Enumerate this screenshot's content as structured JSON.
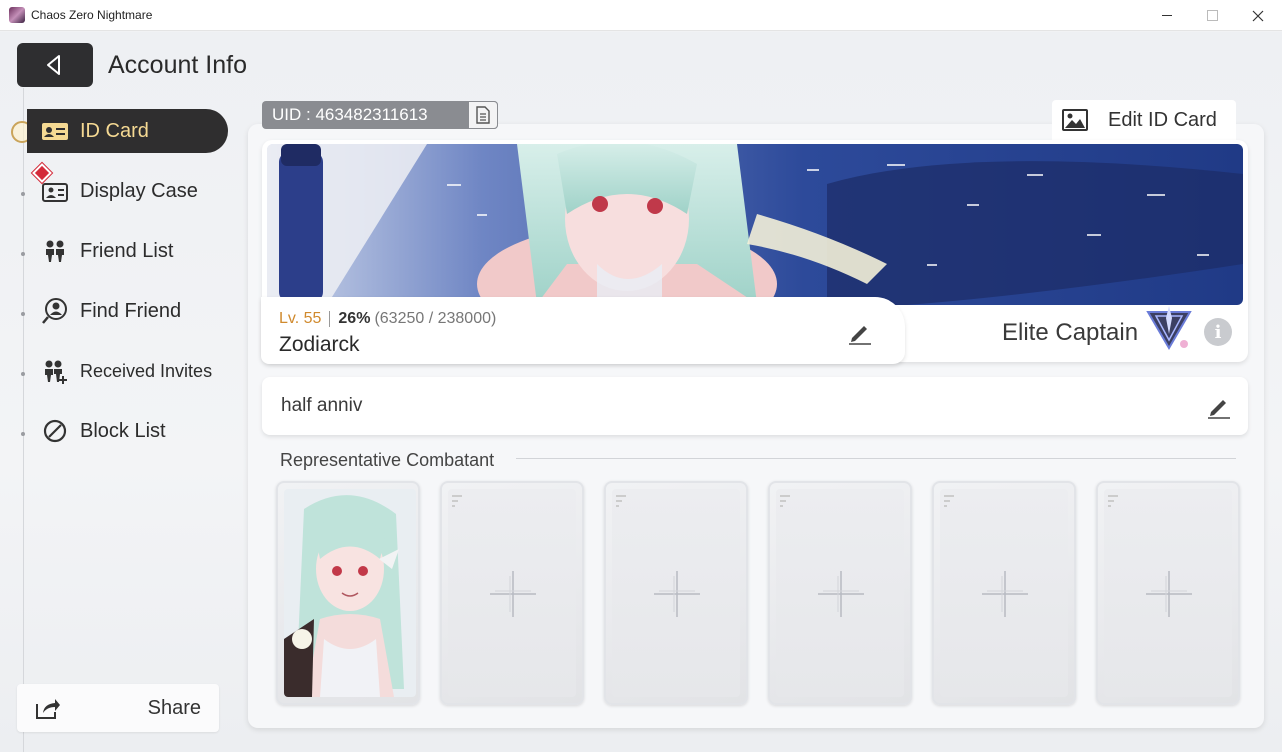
{
  "window": {
    "title": "Chaos Zero Nightmare"
  },
  "header": {
    "page_title": "Account Info"
  },
  "sidebar": {
    "items": [
      {
        "label": "ID Card",
        "icon": "id-card-icon",
        "active": true
      },
      {
        "label": "Display Case",
        "icon": "display-case-icon",
        "active": false,
        "badge": "new"
      },
      {
        "label": "Friend List",
        "icon": "friends-icon",
        "active": false
      },
      {
        "label": "Find Friend",
        "icon": "find-friend-icon",
        "active": false
      },
      {
        "label": "Received Invites",
        "icon": "received-invites-icon",
        "active": false
      },
      {
        "label": "Block List",
        "icon": "block-icon",
        "active": false
      }
    ],
    "share_label": "Share"
  },
  "profile": {
    "uid": "UID : 463482311613",
    "edit_card_label": "Edit ID Card",
    "level_label": "Lv. 55",
    "exp_percent": "26%",
    "exp_detail": "(63250 / 238000)",
    "name": "Zodiarck",
    "rank_title": "Elite Captain",
    "motto": "half anniv"
  },
  "representative": {
    "title": "Representative Combatant",
    "slots": [
      {
        "filled": true
      },
      {
        "filled": false
      },
      {
        "filled": false
      },
      {
        "filled": false
      },
      {
        "filled": false
      },
      {
        "filled": false
      }
    ]
  },
  "colors": {
    "active_nav_bg": "#2f2e2f",
    "active_nav_text": "#f5d993",
    "level_accent": "#d08a2e",
    "uid_bg": "#8a8c91"
  }
}
